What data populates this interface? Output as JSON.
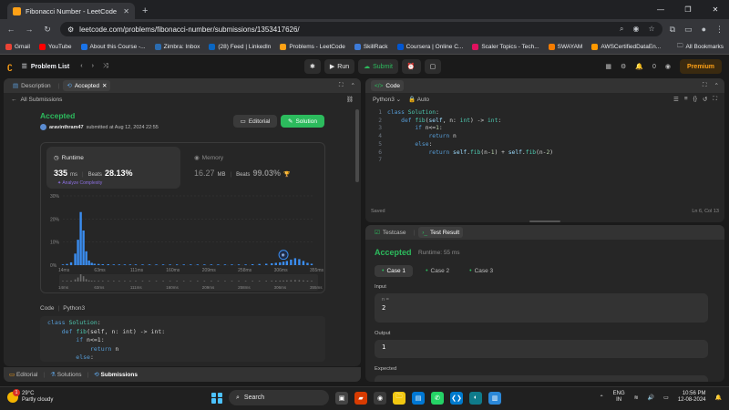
{
  "browser": {
    "tab_title": "Fibonacci Number - LeetCode",
    "url": "leetcode.com/problems/fibonacci-number/submissions/1353417626/",
    "bookmarks": [
      {
        "label": "Gmail",
        "color": "#ea4335"
      },
      {
        "label": "YouTube",
        "color": "#ff0000"
      },
      {
        "label": "About this Course -...",
        "color": "#1a73e8"
      },
      {
        "label": "Zimbra: Inbox",
        "color": "#2b6cb0"
      },
      {
        "label": "(28) Feed | LinkedIn",
        "color": "#0a66c2"
      },
      {
        "label": "Problems - LeetCode",
        "color": "#ffa116"
      },
      {
        "label": "SkillRack",
        "color": "#3d7bd9"
      },
      {
        "label": "Coursera | Online C...",
        "color": "#0056d2"
      },
      {
        "label": "Scaler Topics - Tech...",
        "color": "#e0115f"
      },
      {
        "label": "SWAYAM",
        "color": "#f57c00"
      },
      {
        "label": "AWSCertifiedDataEn...",
        "color": "#ff9900"
      }
    ],
    "all_bookmarks": "All Bookmarks"
  },
  "nav": {
    "problem_list": "Problem List",
    "run": "Run",
    "submit": "Submit",
    "coins": "0",
    "premium": "Premium"
  },
  "left": {
    "tabs": {
      "description": "Description",
      "accepted": "Accepted"
    },
    "all_submissions": "All Submissions",
    "status": "Accepted",
    "user": "aravinthram47",
    "submitted_text": "submitted at Aug 12, 2024 22:55",
    "editorial": "Editorial",
    "solution": "Solution",
    "runtime": {
      "label": "Runtime",
      "value": "335",
      "unit": "ms",
      "beats_label": "Beats",
      "beats": "28.13%",
      "analyze": "Analyze Complexity"
    },
    "memory": {
      "label": "Memory",
      "value": "16.27",
      "unit": "MB",
      "beats_label": "Beats",
      "beats": "99.03%"
    },
    "code_label": "Code",
    "code_lang": "Python3",
    "code_lines": [
      {
        "kw": "class ",
        "cls": "Solution",
        "rest": ":"
      },
      {
        "kw": "    def ",
        "cls": "fib",
        "rest": "(self, n: int) -> int:"
      },
      {
        "kw": "        if ",
        "cls": "",
        "rest": "n<=1:"
      },
      {
        "kw": "            return ",
        "cls": "",
        "rest": "n"
      },
      {
        "kw": "        else",
        "cls": "",
        "rest": ":"
      }
    ],
    "bottom_tabs": {
      "editorial": "Editorial",
      "solutions": "Solutions",
      "submissions": "Submissions"
    }
  },
  "chart_data": {
    "type": "bar",
    "ylabels": [
      "30%",
      "20%",
      "10%",
      "0%"
    ],
    "ylim": [
      0,
      30
    ],
    "xlabels": [
      "14ms",
      "63ms",
      "111ms",
      "160ms",
      "209ms",
      "258ms",
      "306ms",
      "355ms"
    ],
    "xlim": [
      14,
      380
    ],
    "highlight_x": 335,
    "values": [
      [
        14,
        0.3
      ],
      [
        20,
        0.5
      ],
      [
        26,
        1.2
      ],
      [
        32,
        5
      ],
      [
        36,
        11
      ],
      [
        40,
        23
      ],
      [
        44,
        15
      ],
      [
        48,
        6
      ],
      [
        52,
        2
      ],
      [
        56,
        1
      ],
      [
        60,
        0.6
      ],
      [
        66,
        0.5
      ],
      [
        72,
        0.4
      ],
      [
        80,
        0.4
      ],
      [
        88,
        0.3
      ],
      [
        96,
        0.3
      ],
      [
        104,
        0.3
      ],
      [
        112,
        0.3
      ],
      [
        120,
        0.3
      ],
      [
        130,
        0.3
      ],
      [
        140,
        0.3
      ],
      [
        150,
        0.3
      ],
      [
        160,
        0.3
      ],
      [
        170,
        0.3
      ],
      [
        180,
        0.3
      ],
      [
        190,
        0.3
      ],
      [
        200,
        0.3
      ],
      [
        210,
        0.3
      ],
      [
        220,
        0.3
      ],
      [
        230,
        0.3
      ],
      [
        240,
        0.3
      ],
      [
        250,
        0.3
      ],
      [
        260,
        0.3
      ],
      [
        270,
        0.3
      ],
      [
        280,
        0.3
      ],
      [
        290,
        0.4
      ],
      [
        300,
        0.5
      ],
      [
        310,
        0.6
      ],
      [
        318,
        0.8
      ],
      [
        324,
        1.0
      ],
      [
        330,
        1.2
      ],
      [
        335,
        1.5
      ],
      [
        340,
        1.8
      ],
      [
        346,
        2.4
      ],
      [
        352,
        3.0
      ],
      [
        358,
        2.6
      ],
      [
        364,
        1.8
      ],
      [
        370,
        1.0
      ],
      [
        376,
        0.6
      ]
    ]
  },
  "right": {
    "code_tab": "Code",
    "lang": "Python3",
    "auto": "Auto",
    "lines": [
      "class Solution:",
      "    def fib(self, n: int) -> int:",
      "        if n<=1:",
      "            return n",
      "        else:",
      "            return self.fib(n-1) + self.fib(n-2)",
      ""
    ],
    "saved": "Saved",
    "cursor": "Ln 6, Col 13",
    "testcase": "Testcase",
    "test_result": "Test Result",
    "result_status": "Accepted",
    "result_runtime": "Runtime: 55 ms",
    "cases": [
      "Case 1",
      "Case 2",
      "Case 3"
    ],
    "input_label": "Input",
    "input_var": "n =",
    "input_value": "2",
    "output_label": "Output",
    "output_value": "1",
    "expected_label": "Expected"
  },
  "taskbar": {
    "temp": "29°C",
    "weather": "Partly cloudy",
    "weather_badge": "1",
    "search": "Search",
    "lang1": "ENG",
    "lang2": "IN",
    "time": "10:56 PM",
    "date": "12-08-2024"
  }
}
